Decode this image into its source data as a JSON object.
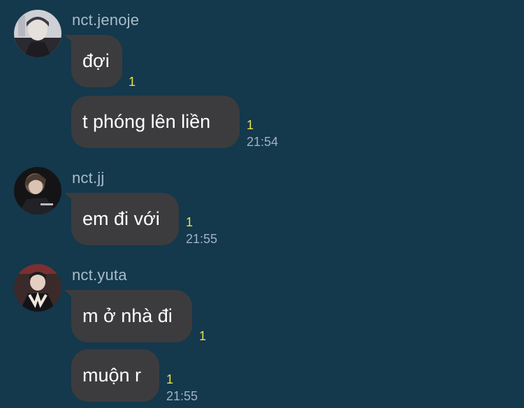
{
  "chat": {
    "messages": [
      {
        "username": "nct.jenoje",
        "avatar_icon": "profile-photo-icon",
        "bubbles": [
          {
            "text": "đợi",
            "unread": "1"
          },
          {
            "text": "t phóng lên liền",
            "unread": "1",
            "time": "21:54"
          }
        ]
      },
      {
        "username": "nct.jj",
        "avatar_icon": "profile-photo-icon",
        "bubbles": [
          {
            "text": "em đi với",
            "unread": "1",
            "time": "21:55"
          }
        ]
      },
      {
        "username": "nct.yuta",
        "avatar_icon": "profile-photo-icon",
        "bubbles": [
          {
            "text": "m ở nhà đi",
            "unread": "1"
          },
          {
            "text": "muộn r",
            "unread": "1",
            "time": "21:55"
          }
        ]
      }
    ]
  },
  "colors": {
    "background": "#14384c",
    "bubble": "#3c3c3e",
    "unread": "#e8e24a",
    "time": "#9fb3c2",
    "username": "#a9bcc9"
  }
}
